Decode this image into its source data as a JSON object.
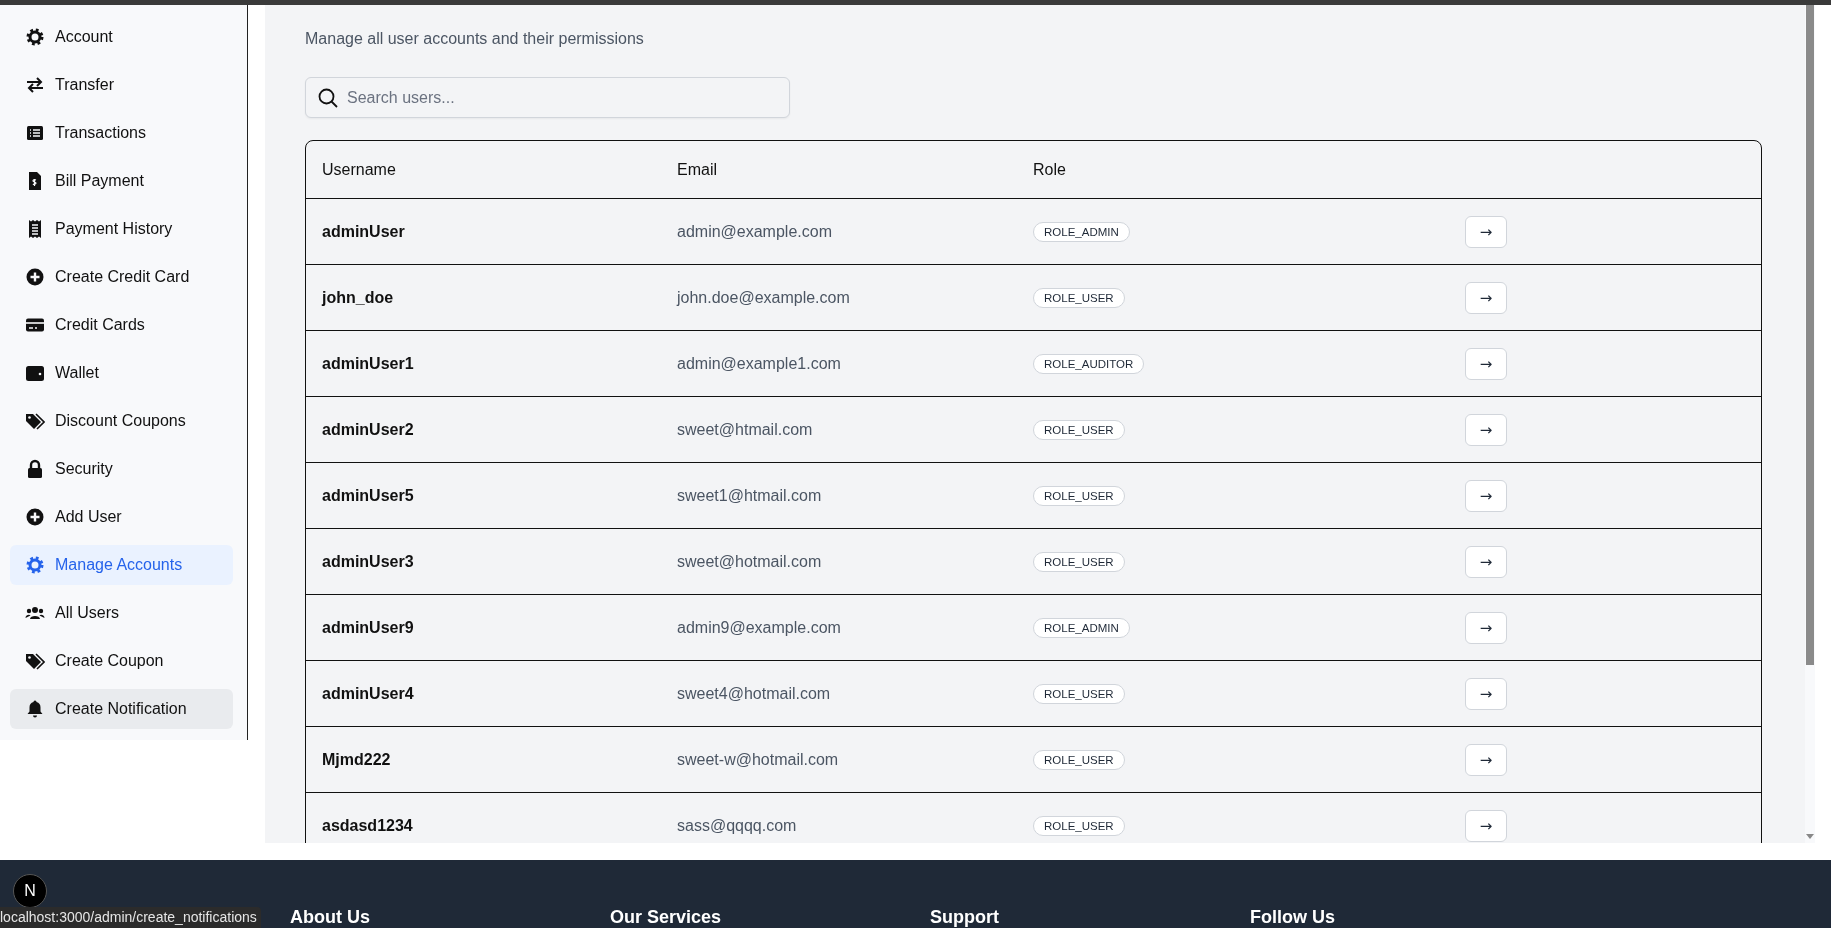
{
  "sidebar": {
    "items": [
      {
        "label": "Account",
        "selected": false,
        "hovered": false
      },
      {
        "label": "Transfer",
        "selected": false,
        "hovered": false
      },
      {
        "label": "Transactions",
        "selected": false,
        "hovered": false
      },
      {
        "label": "Bill Payment",
        "selected": false,
        "hovered": false
      },
      {
        "label": "Payment History",
        "selected": false,
        "hovered": false
      },
      {
        "label": "Create Credit Card",
        "selected": false,
        "hovered": false
      },
      {
        "label": "Credit Cards",
        "selected": false,
        "hovered": false
      },
      {
        "label": "Wallet",
        "selected": false,
        "hovered": false
      },
      {
        "label": "Discount Coupons",
        "selected": false,
        "hovered": false
      },
      {
        "label": "Security",
        "selected": false,
        "hovered": false
      },
      {
        "label": "Add User",
        "selected": false,
        "hovered": false
      },
      {
        "label": "Manage Accounts",
        "selected": true,
        "hovered": false
      },
      {
        "label": "All Users",
        "selected": false,
        "hovered": false
      },
      {
        "label": "Create Coupon",
        "selected": false,
        "hovered": false
      },
      {
        "label": "Create Notification",
        "selected": false,
        "hovered": true
      }
    ]
  },
  "main": {
    "subtitle": "Manage all user accounts and their permissions",
    "search": {
      "placeholder": "Search users..."
    },
    "table": {
      "columns": [
        "Username",
        "Email",
        "Role"
      ],
      "rows": [
        {
          "username": "adminUser",
          "email": "admin@example.com",
          "role": "ROLE_ADMIN",
          "action": "→"
        },
        {
          "username": "john_doe",
          "email": "john.doe@example.com",
          "role": "ROLE_USER",
          "action": "→"
        },
        {
          "username": "adminUser1",
          "email": "admin@example1.com",
          "role": "ROLE_AUDITOR",
          "action": "→"
        },
        {
          "username": "adminUser2",
          "email": "sweet@htmail.com",
          "role": "ROLE_USER",
          "action": "→"
        },
        {
          "username": "adminUser5",
          "email": "sweet1@htmail.com",
          "role": "ROLE_USER",
          "action": "→"
        },
        {
          "username": "adminUser3",
          "email": "sweet@hotmail.com",
          "role": "ROLE_USER",
          "action": "→"
        },
        {
          "username": "adminUser9",
          "email": "admin9@example.com",
          "role": "ROLE_ADMIN",
          "action": "→"
        },
        {
          "username": "adminUser4",
          "email": "sweet4@hotmail.com",
          "role": "ROLE_USER",
          "action": "→"
        },
        {
          "username": "Mjmd222",
          "email": "sweet-w@hotmail.com",
          "role": "ROLE_USER",
          "action": "→"
        },
        {
          "username": "asdasd1234",
          "email": "sass@qqqq.com",
          "role": "ROLE_USER",
          "action": "→"
        }
      ]
    }
  },
  "footer": {
    "headings": [
      "About Us",
      "Our Services",
      "Support",
      "Follow Us"
    ]
  },
  "dev_badge": {
    "label": "N"
  },
  "status_bar": {
    "url": "localhost:3000/admin/create_notifications"
  }
}
